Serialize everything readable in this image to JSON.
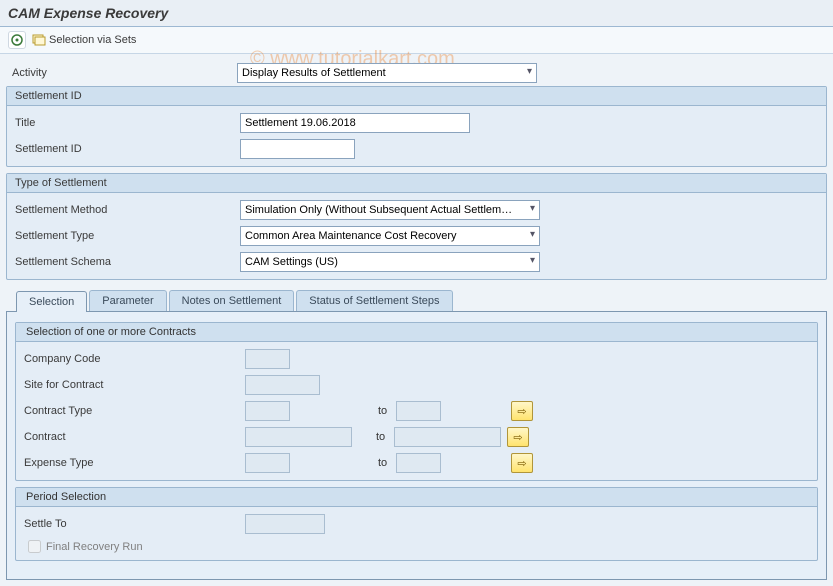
{
  "header": {
    "title": "CAM Expense Recovery"
  },
  "toolbar": {
    "selection_via_sets": "Selection via Sets"
  },
  "watermark": "© www.tutorialkart.com",
  "activity": {
    "label": "Activity",
    "value": "Display Results of Settlement"
  },
  "settlement_id": {
    "group_title": "Settlement ID",
    "title_label": "Title",
    "title_value": "Settlement 19.06.2018",
    "id_label": "Settlement ID",
    "id_value": ""
  },
  "type_of_settlement": {
    "group_title": "Type of Settlement",
    "method_label": "Settlement Method",
    "method_value": "Simulation Only (Without Subsequent Actual Settlem…",
    "type_label": "Settlement Type",
    "type_value": "Common Area Maintenance Cost Recovery",
    "schema_label": "Settlement Schema",
    "schema_value": "CAM Settings (US)"
  },
  "tabs": {
    "selection": "Selection",
    "parameter": "Parameter",
    "notes": "Notes on Settlement",
    "status": "Status of Settlement Steps"
  },
  "contracts": {
    "group_title": "Selection of one or more Contracts",
    "company_code": "Company Code",
    "site": "Site for Contract",
    "contract_type": "Contract Type",
    "contract": "Contract",
    "expense_type": "Expense Type",
    "to": "to"
  },
  "period": {
    "group_title": "Period Selection",
    "settle_to": "Settle To",
    "final_recovery": "Final Recovery Run"
  }
}
